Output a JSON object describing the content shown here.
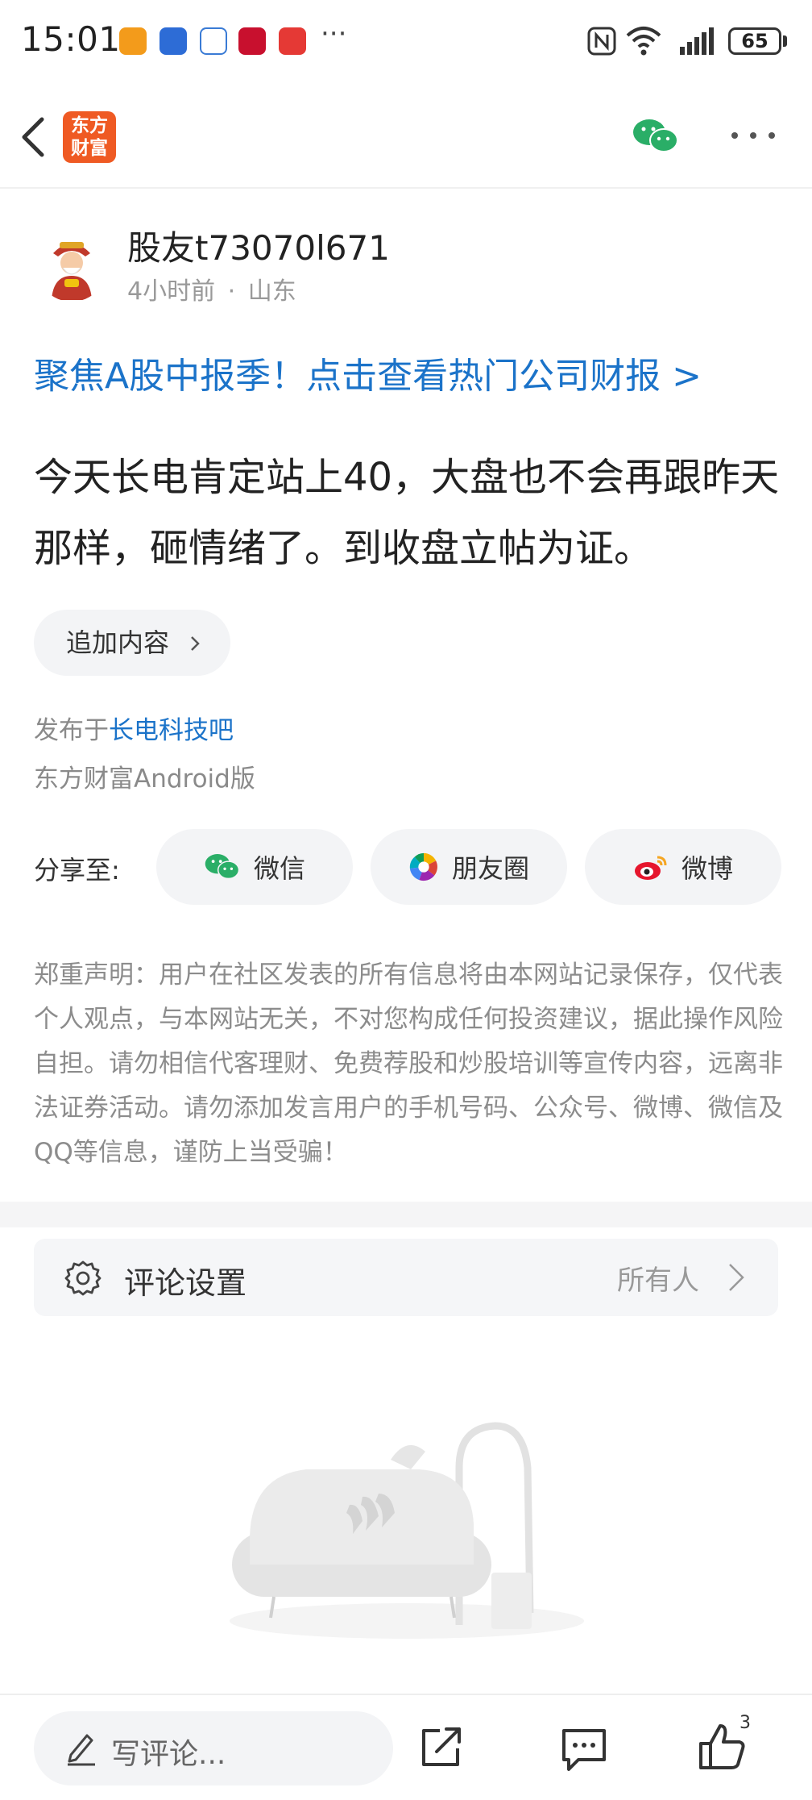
{
  "status_bar": {
    "time": "15:01",
    "more": "···",
    "battery": "65",
    "app_colors": [
      "#f39b1b",
      "#2d6cd6",
      "#3a7bd5",
      "#c8102e",
      "#e53935"
    ]
  },
  "top_bar": {
    "logo_text": "东方\n财富",
    "brand_color": "#ef5a23"
  },
  "post": {
    "author": "股友t73070l671",
    "time": "4小时前",
    "separator": "·",
    "location": "山东",
    "promo_link": "聚焦A股中报季！点击查看热门公司财报 >",
    "body": "今天长电肯定站上40，大盘也不会再跟昨天那样，砸情绪了。到收盘立帖为证。",
    "append_button": "追加内容",
    "published_prefix": "发布于",
    "published_in": "长电科技吧",
    "platform": "东方财富Android版"
  },
  "share": {
    "label": "分享至:",
    "wechat": "微信",
    "moments": "朋友圈",
    "weibo": "微博"
  },
  "disclaimer": "郑重声明：用户在社区发表的所有信息将由本网站记录保存，仅代表个人观点，与本网站无关，不对您构成任何投资建议，据此操作风险自担。请勿相信代客理财、免费荐股和炒股培训等宣传内容，远离非法证券活动。请勿添加发言用户的手机号码、公众号、微博、微信及QQ等信息，谨防上当受骗！",
  "comment_settings": {
    "label": "评论设置",
    "value": "所有人"
  },
  "bottom_bar": {
    "comment_placeholder": "写评论...",
    "like_count": "3"
  },
  "colors": {
    "link_blue": "#1b73c9",
    "wechat_green": "#2aae67"
  }
}
